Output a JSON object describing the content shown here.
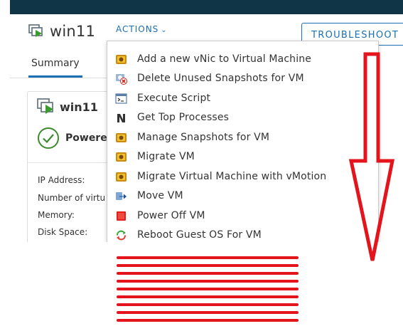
{
  "header": {
    "vm_name": "win11",
    "actions_label": "ACTIONS",
    "troubleshoot_label": "TROUBLESHOOT"
  },
  "tabs": [
    {
      "label": "Summary",
      "active": true
    }
  ],
  "summary_card": {
    "vm_name": "win11",
    "power_state": "Powere",
    "properties": [
      {
        "label": "IP Address:"
      },
      {
        "label": "Number of virtu"
      },
      {
        "label": "Memory:"
      },
      {
        "label": "Disk Space:"
      }
    ]
  },
  "actions_menu": {
    "items": [
      {
        "label": "Add a new vNic to Virtual Machine",
        "icon": "vm-workflow-icon"
      },
      {
        "label": "Delete Unused Snapshots for VM",
        "icon": "delete-snapshot-icon"
      },
      {
        "label": "Execute Script",
        "icon": "terminal-icon"
      },
      {
        "label": "Get Top Processes",
        "icon": "processes-icon"
      },
      {
        "label": "Manage Snapshots for VM",
        "icon": "vm-workflow-icon"
      },
      {
        "label": "Migrate VM",
        "icon": "vm-workflow-icon"
      },
      {
        "label": "Migrate Virtual Machine with vMotion",
        "icon": "vm-workflow-icon"
      },
      {
        "label": "Move VM",
        "icon": "move-vm-icon"
      },
      {
        "label": "Power Off VM",
        "icon": "power-off-icon"
      },
      {
        "label": "Reboot Guest OS For VM",
        "icon": "reboot-icon"
      }
    ]
  },
  "annotation": {
    "arrow_color": "#e3141b",
    "redline_count": 9
  },
  "colors": {
    "topbar": "#0f3546",
    "accent": "#1b6fb5",
    "annotation_red": "#e3141b",
    "power_green": "#3c8a2e"
  }
}
